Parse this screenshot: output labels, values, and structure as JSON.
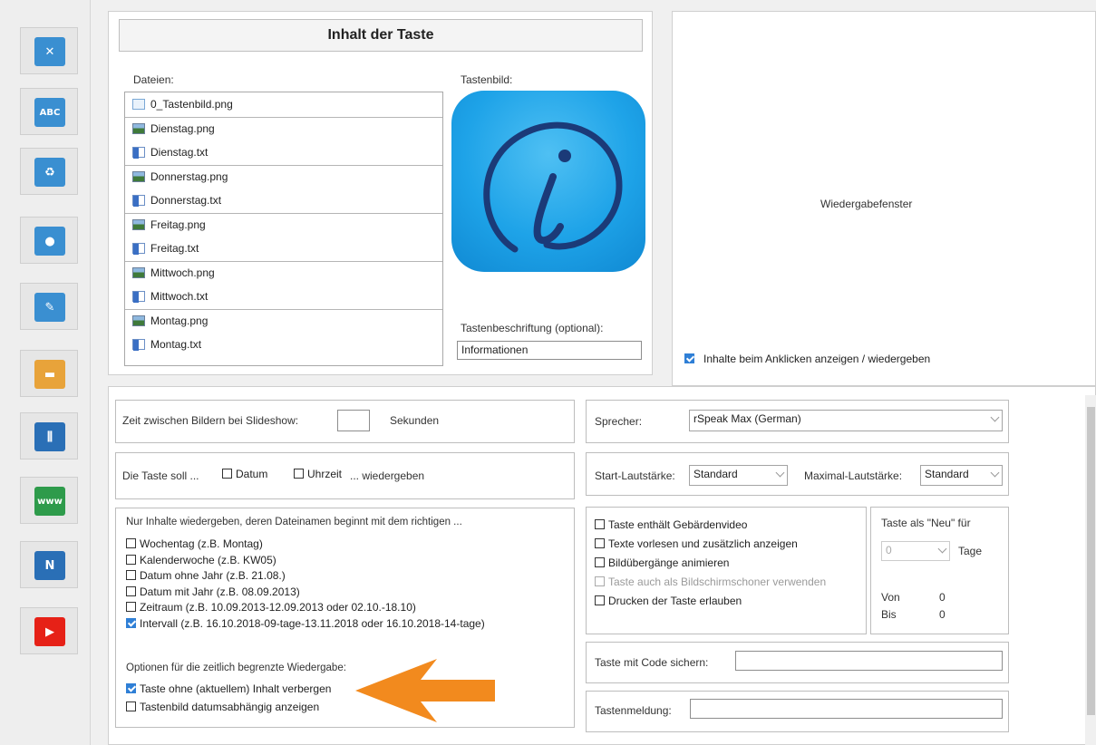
{
  "sidebar": {
    "items": [
      {
        "icon": "tools-icon",
        "glyph": "✕",
        "color": "#3a8fd1"
      },
      {
        "icon": "abc-eraser-icon",
        "glyph": "ABC",
        "color": "#3a8fd1"
      },
      {
        "icon": "trash-icon",
        "glyph": "♻",
        "color": "#3a8fd1"
      },
      {
        "icon": "microphone-icon",
        "glyph": "●",
        "color": "#3a8fd1"
      },
      {
        "icon": "edit-icon",
        "glyph": "✎",
        "color": "#3a8fd1"
      },
      {
        "icon": "folder-icon",
        "glyph": "▬",
        "color": "#e8a33a"
      },
      {
        "icon": "equalizer-icon",
        "glyph": "⫼",
        "color": "#2a6fb6"
      },
      {
        "icon": "www-globe-icon",
        "glyph": "www",
        "color": "#2e9b4b"
      },
      {
        "icon": "n-logo-icon",
        "glyph": "N",
        "color": "#2a6fb6"
      },
      {
        "icon": "youtube-icon",
        "glyph": "▶",
        "color": "#e62117"
      }
    ]
  },
  "content": {
    "title": "Inhalt der Taste",
    "files_label": "Dateien:",
    "image_label": "Tastenbild:",
    "files": [
      {
        "name": "0_Tastenbild.png",
        "type": "first"
      },
      {
        "name": "Dienstag.png",
        "type": "png"
      },
      {
        "name": "Dienstag.txt",
        "type": "txt"
      },
      {
        "name": "Donnerstag.png",
        "type": "png"
      },
      {
        "name": "Donnerstag.txt",
        "type": "txt"
      },
      {
        "name": "Freitag.png",
        "type": "png"
      },
      {
        "name": "Freitag.txt",
        "type": "txt"
      },
      {
        "name": "Mittwoch.png",
        "type": "png"
      },
      {
        "name": "Mittwoch.txt",
        "type": "txt"
      },
      {
        "name": "Montag.png",
        "type": "png"
      },
      {
        "name": "Montag.txt",
        "type": "txt"
      }
    ],
    "caption_label": "Tastenbeschriftung (optional):",
    "caption_value": "Informationen",
    "key_icon": "info-icon"
  },
  "preview": {
    "label": "Wiedergabefenster",
    "show_on_click": "Inhalte beim Anklicken anzeigen / wiedergeben"
  },
  "settings": {
    "slideshow_label": "Zeit zwischen Bildern bei Slideshow:",
    "slideshow_value": "",
    "slideshow_unit": "Sekunden",
    "key_should": "Die Taste soll ...",
    "date_opt": "Datum",
    "time_opt": "Uhrzeit",
    "play_suffix": "... wiedergeben",
    "filter_header": "Nur Inhalte wiedergeben, deren Dateinamen beginnt mit dem richtigen ...",
    "filters": [
      {
        "label": "Wochentag (z.B. Montag)",
        "checked": false
      },
      {
        "label": "Kalenderwoche (z.B. KW05)",
        "checked": false
      },
      {
        "label": "Datum ohne Jahr (z.B. 21.08.)",
        "checked": false
      },
      {
        "label": "Datum mit Jahr (z.B. 08.09.2013)",
        "checked": false
      },
      {
        "label": "Zeitraum (z.B. 10.09.2013-12.09.2013 oder 02.10.-18.10)",
        "checked": false
      },
      {
        "label": "Intervall (z.B. 16.10.2018-09-tage-13.11.2018 oder 16.10.2018-14-tage)",
        "checked": true
      }
    ],
    "time_options_header": "Optionen für die zeitlich begrenzte Wiedergabe:",
    "time_options": [
      {
        "label": "Taste ohne (aktuellem) Inhalt verbergen",
        "checked": true
      },
      {
        "label": "Tastenbild datumsabhängig anzeigen",
        "checked": false
      }
    ],
    "speaker_label": "Sprecher:",
    "speaker_value": "rSpeak Max (German)",
    "start_volume_label": "Start-Lautstärke:",
    "start_volume_value": "Standard",
    "max_volume_label": "Maximal-Lautstärke:",
    "max_volume_value": "Standard",
    "feature_options": [
      {
        "label": "Taste enthält Gebärdenvideo",
        "checked": false,
        "disabled": false
      },
      {
        "label": "Texte vorlesen und zusätzlich anzeigen",
        "checked": false,
        "disabled": false
      },
      {
        "label": "Bildübergänge animieren",
        "checked": false,
        "disabled": false
      },
      {
        "label": "Taste auch als Bildschirmschoner verwenden",
        "checked": false,
        "disabled": true
      },
      {
        "label": "Drucken der Taste erlauben",
        "checked": false,
        "disabled": false
      }
    ],
    "new_label": "Taste als \"Neu\" für",
    "new_value": "0",
    "days_label": "Tage",
    "from_label": "Von",
    "from_value": "0",
    "to_label": "Bis",
    "to_value": "0",
    "code_label": "Taste mit Code sichern:",
    "code_value": "",
    "message_label": "Tastenmeldung:",
    "message_value": ""
  },
  "annotation": {
    "color": "#f28a1e"
  }
}
